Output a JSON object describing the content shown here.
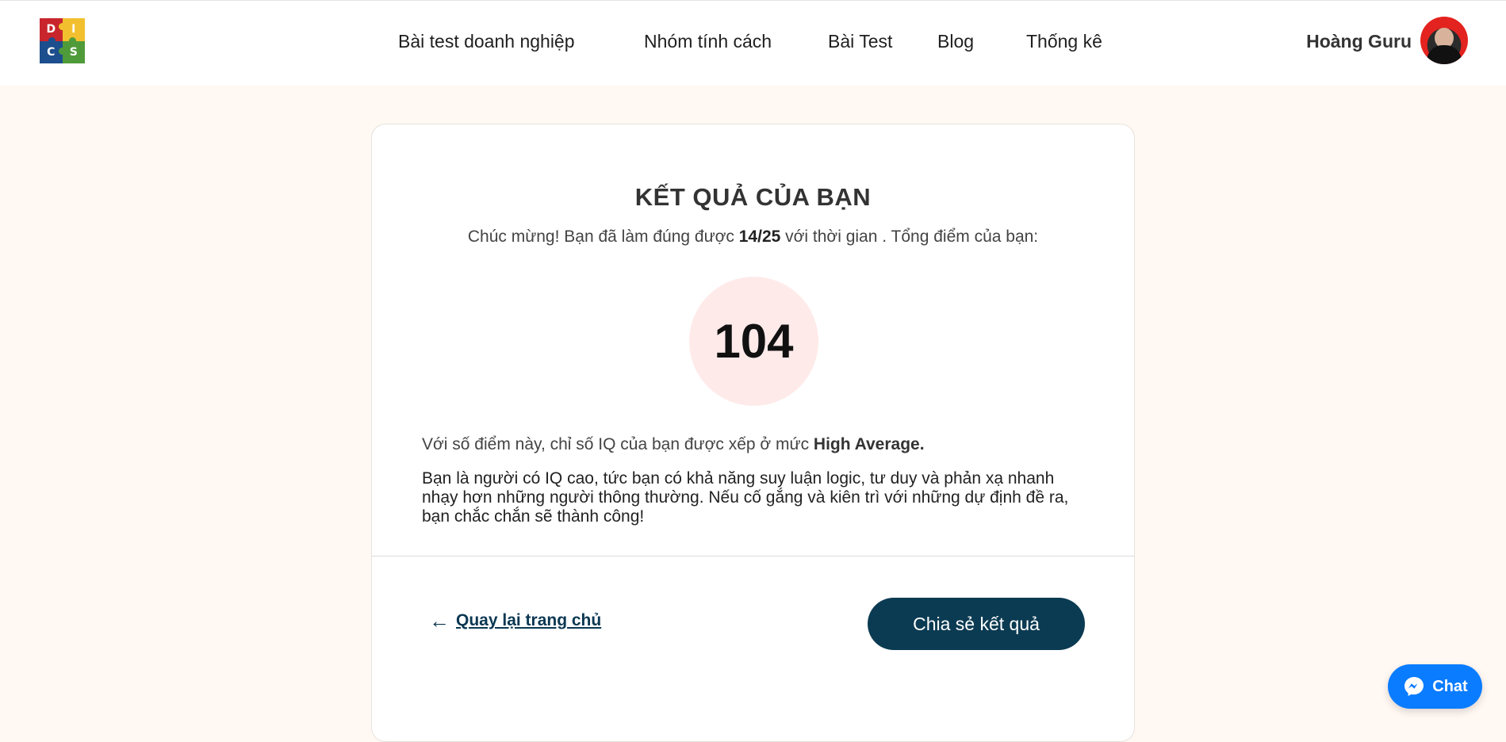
{
  "header": {
    "logo": {
      "icon": "puzzle-logo-icon",
      "letters": [
        "D",
        "I",
        "C",
        "S"
      ],
      "colors": [
        "#c8262c",
        "#f2c02f",
        "#1d4e8d",
        "#4f9b39"
      ]
    },
    "nav": {
      "items": [
        {
          "label": "Bài test doanh nghiệp"
        },
        {
          "label": "Nhóm tính cách"
        },
        {
          "label": "Bài Test"
        },
        {
          "label": "Blog"
        },
        {
          "label": "Thống kê"
        }
      ]
    },
    "user": {
      "name": "Hoàng Guru",
      "avatar_icon": "user-avatar"
    }
  },
  "result": {
    "title": "KẾT QUẢ CỦA BẠN",
    "subtitle_prefix": "Chúc mừng! Bạn đã làm đúng được ",
    "correct": "14/25",
    "subtitle_suffix": " với thời gian . Tổng điểm của bạn:",
    "score": "104",
    "level_prefix": "Với số điểm này, chỉ số IQ của bạn được xếp ở mức ",
    "level": "High Average.",
    "description": "Bạn là người có IQ cao, tức bạn có khả năng suy luận logic, tư duy và phản xạ nhanh nhạy hơn những người thông thường. Nếu cố gắng và kiên trì với những dự định đề ra, bạn chắc chắn sẽ thành công!"
  },
  "actions": {
    "back_arrow": "←",
    "back_label": "Quay lại trang chủ",
    "share_label": "Chia sẻ kết quả"
  },
  "chat": {
    "label": "Chat",
    "icon": "messenger-icon",
    "color": "#0a7cff"
  },
  "colors": {
    "page_background": "#fff8f3",
    "primary_dark": "#0b3b52",
    "score_circle": "#ffeaea"
  }
}
